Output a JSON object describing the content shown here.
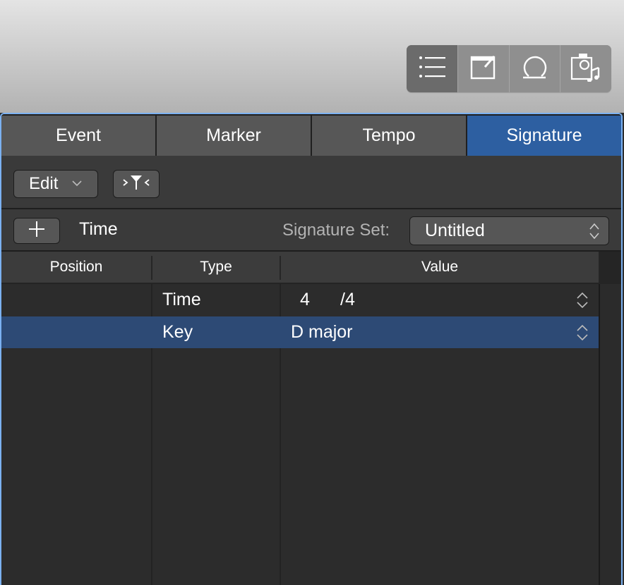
{
  "view_buttons": [
    {
      "icon": "list-icon",
      "active": true
    },
    {
      "icon": "note-pad-icon",
      "active": false
    },
    {
      "icon": "loop-icon",
      "active": false
    },
    {
      "icon": "media-browser-icon",
      "active": false
    }
  ],
  "tabs": [
    {
      "label": "Event"
    },
    {
      "label": "Marker"
    },
    {
      "label": "Tempo"
    },
    {
      "label": "Signature",
      "selected": true
    }
  ],
  "toolbar": {
    "edit_label": "Edit",
    "filter_glyph": ">Y<"
  },
  "setbar": {
    "add_label": "+",
    "time_label": "Time",
    "signature_set_label": "Signature Set:",
    "signature_set_value": "Untitled"
  },
  "columns": {
    "position": "Position",
    "type": "Type",
    "value": "Value"
  },
  "rows": [
    {
      "position": "",
      "type": "Time",
      "value_numerator": "4",
      "value_denominator": "/4",
      "selected": false
    },
    {
      "position": "",
      "type": "Key",
      "value": "D major",
      "selected": true
    }
  ],
  "colors": {
    "selection": "#2d4a75",
    "selected_tab": "#2d5fa1",
    "focus_ring": "#7bb1f1"
  }
}
